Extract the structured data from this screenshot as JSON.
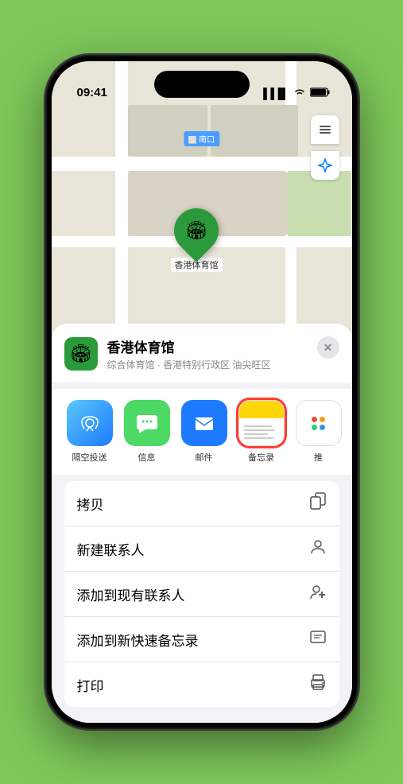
{
  "status_bar": {
    "time": "09:41",
    "signal": "●●●●",
    "wifi": "WiFi",
    "battery": "Battery"
  },
  "map": {
    "label": "南口",
    "pin_label": "香港体育馆"
  },
  "venue": {
    "name": "香港体育馆",
    "subtitle": "综合体育馆 · 香港特别行政区 油尖旺区",
    "icon": "🏟"
  },
  "share_items": [
    {
      "id": "airdrop",
      "label": "隔空投送",
      "emoji": "📡"
    },
    {
      "id": "message",
      "label": "信息",
      "emoji": "💬"
    },
    {
      "id": "mail",
      "label": "邮件",
      "emoji": "✉️"
    },
    {
      "id": "notes",
      "label": "备忘录",
      "is_notes": true,
      "selected": true
    },
    {
      "id": "more",
      "label": "推",
      "is_more": true
    }
  ],
  "actions": [
    {
      "id": "copy",
      "label": "拷贝",
      "icon": "⎘"
    },
    {
      "id": "new-contact",
      "label": "新建联系人",
      "icon": "👤"
    },
    {
      "id": "add-existing",
      "label": "添加到现有联系人",
      "icon": "👤"
    },
    {
      "id": "add-notes",
      "label": "添加到新快速备忘录",
      "icon": "▭"
    },
    {
      "id": "print",
      "label": "打印",
      "icon": "🖨"
    }
  ],
  "close_label": "✕",
  "map_controls": {
    "layers": "🗺",
    "location": "➤"
  }
}
